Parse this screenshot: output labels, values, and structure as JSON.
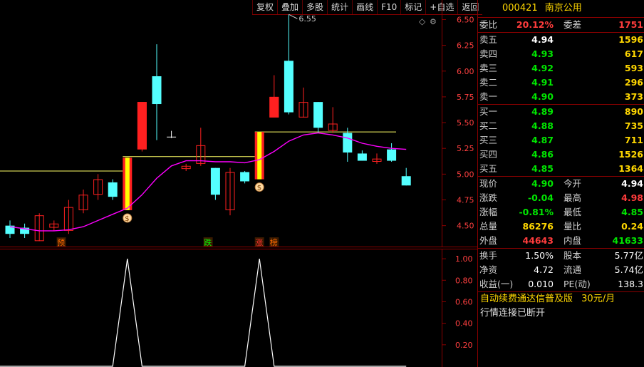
{
  "toolbar": [
    "复权",
    "叠加",
    "多股",
    "统计",
    "画线",
    "F10",
    "标记",
    "+自选",
    "返回"
  ],
  "stock": {
    "code": "000421",
    "name": "南京公用"
  },
  "ratio": {
    "label": "委比",
    "value": "20.12%",
    "label2": "委差",
    "value2": "1751"
  },
  "asks": [
    {
      "label": "卖五",
      "price": "4.94",
      "vol": "1596"
    },
    {
      "label": "卖四",
      "price": "4.93",
      "vol": "617"
    },
    {
      "label": "卖三",
      "price": "4.92",
      "vol": "593"
    },
    {
      "label": "卖二",
      "price": "4.91",
      "vol": "296"
    },
    {
      "label": "卖一",
      "price": "4.90",
      "vol": "373"
    }
  ],
  "bids": [
    {
      "label": "买一",
      "price": "4.89",
      "vol": "890"
    },
    {
      "label": "买二",
      "price": "4.88",
      "vol": "735"
    },
    {
      "label": "买三",
      "price": "4.87",
      "vol": "711"
    },
    {
      "label": "买四",
      "price": "4.86",
      "vol": "1526"
    },
    {
      "label": "买五",
      "price": "4.85",
      "vol": "1364"
    }
  ],
  "quote": [
    {
      "l1": "现价",
      "v1": "4.90",
      "c1": "green",
      "l2": "今开",
      "v2": "4.94",
      "c2": "white"
    },
    {
      "l1": "涨跌",
      "v1": "-0.04",
      "c1": "green",
      "l2": "最高",
      "v2": "4.98",
      "c2": "red"
    },
    {
      "l1": "涨幅",
      "v1": "-0.81%",
      "c1": "green",
      "l2": "最低",
      "v2": "4.85",
      "c2": "green"
    },
    {
      "l1": "总量",
      "v1": "86276",
      "c1": "yellow",
      "l2": "量比",
      "v2": "0.24",
      "c2": "yellow"
    },
    {
      "l1": "外盘",
      "v1": "44643",
      "c1": "red",
      "l2": "内盘",
      "v2": "41633",
      "c2": "green"
    }
  ],
  "fundamentals": [
    {
      "l1": "换手",
      "v1": "1.50%",
      "l2": "股本",
      "v2": "5.77亿"
    },
    {
      "l1": "净资",
      "v1": "4.72",
      "l2": "流通",
      "v2": "5.74亿"
    },
    {
      "l1": "收益(一)",
      "v1": "0.010",
      "l2": "PE(动)",
      "v2": "138.3"
    }
  ],
  "promo": {
    "text": "自动续费通达信普及版",
    "price": "30元/月"
  },
  "status": "行情连接已断开",
  "colors": {
    "up": "#ff2020",
    "down": "#54ffff",
    "ma": "#ff00ff",
    "ref_line": "#ffff66",
    "border": "#8b0000"
  },
  "chart_data": [
    {
      "type": "candlestick",
      "price_axis": {
        "ticks": [
          "6.50",
          "6.25",
          "6.00",
          "5.75",
          "5.50",
          "5.25",
          "5.00",
          "4.75",
          "4.50"
        ],
        "range": [
          4.29,
          6.69
        ]
      },
      "peak_label": "6.55",
      "candles": [
        {
          "o": 4.5,
          "c": 4.42,
          "h": 4.55,
          "l": 4.38
        },
        {
          "o": 4.48,
          "c": 4.42,
          "h": 4.52,
          "l": 4.38
        },
        {
          "o": 4.35,
          "c": 4.6,
          "h": 4.62,
          "l": 4.35
        },
        {
          "o": 4.48,
          "c": 4.52,
          "h": 4.55,
          "l": 4.45
        },
        {
          "o": 4.45,
          "c": 4.68,
          "h": 4.75,
          "l": 4.42
        },
        {
          "o": 4.65,
          "c": 4.8,
          "h": 4.85,
          "l": 4.62
        },
        {
          "o": 4.8,
          "c": 4.95,
          "h": 5.0,
          "l": 4.75
        },
        {
          "o": 4.92,
          "c": 4.78,
          "h": 4.95,
          "l": 4.75
        },
        {
          "o": 4.65,
          "c": 5.16,
          "h": 5.16,
          "l": 4.65,
          "limit": true
        },
        {
          "o": 5.24,
          "c": 5.7,
          "h": 5.7,
          "l": 5.22
        },
        {
          "o": 5.95,
          "c": 5.68,
          "h": 6.26,
          "l": 5.33
        },
        {
          "o": 5.36,
          "c": 5.36,
          "h": 5.42,
          "l": 5.35
        },
        {
          "o": 5.05,
          "c": 5.08,
          "h": 5.1,
          "l": 5.03
        },
        {
          "o": 5.1,
          "c": 5.28,
          "h": 5.45,
          "l": 5.08
        },
        {
          "o": 5.06,
          "c": 4.8,
          "h": 5.06,
          "l": 4.75
        },
        {
          "o": 4.65,
          "c": 5.02,
          "h": 5.06,
          "l": 4.6
        },
        {
          "o": 5.02,
          "c": 4.93,
          "h": 5.03,
          "l": 4.91
        },
        {
          "o": 4.95,
          "c": 5.41,
          "h": 5.41,
          "l": 4.95,
          "limit": true
        },
        {
          "o": 5.55,
          "c": 5.75,
          "h": 5.96,
          "l": 5.55
        },
        {
          "o": 6.1,
          "c": 5.6,
          "h": 6.55,
          "l": 5.58
        },
        {
          "o": 5.55,
          "c": 5.7,
          "h": 5.84,
          "l": 5.55
        },
        {
          "o": 5.7,
          "c": 5.45,
          "h": 5.7,
          "l": 5.4
        },
        {
          "o": 5.42,
          "c": 5.49,
          "h": 5.65,
          "l": 5.4
        },
        {
          "o": 5.4,
          "c": 5.21,
          "h": 5.45,
          "l": 5.12
        },
        {
          "o": 5.2,
          "c": 5.13,
          "h": 5.23,
          "l": 5.13
        },
        {
          "o": 5.12,
          "c": 5.15,
          "h": 5.2,
          "l": 5.1
        },
        {
          "o": 5.24,
          "c": 5.13,
          "h": 5.3,
          "l": 5.12
        },
        {
          "o": 4.98,
          "c": 4.89,
          "h": 5.06,
          "l": 4.89
        }
      ],
      "ma": [
        4.49,
        4.47,
        4.45,
        4.45,
        4.46,
        4.49,
        4.55,
        4.61,
        4.67,
        4.8,
        4.96,
        5.08,
        5.13,
        5.13,
        5.12,
        5.12,
        5.11,
        5.14,
        5.22,
        5.32,
        5.38,
        5.4,
        5.38,
        5.35,
        5.3,
        5.27,
        5.25,
        5.24
      ],
      "ref_lines": [
        {
          "price": 5.03,
          "from": 0,
          "to": 8
        },
        {
          "price": 5.17,
          "from": 8,
          "to": 17
        },
        {
          "price": 5.41,
          "from": 17,
          "to": 28
        }
      ],
      "signals": [
        {
          "index": 3.5,
          "text": "预",
          "color": "#ff6a00"
        },
        {
          "index": 13.5,
          "text": "跌",
          "color": "#00ff00"
        },
        {
          "index": 17.0,
          "text": "涨",
          "color": "#ff3030"
        },
        {
          "index": 18.0,
          "text": "榜",
          "color": "#ff6a00"
        }
      ]
    },
    {
      "type": "line",
      "y_axis": {
        "ticks": [
          "1.00",
          "0.80",
          "0.60",
          "0.40",
          "0.20"
        ],
        "range": [
          0,
          1.1
        ]
      },
      "values": [
        0,
        0,
        0,
        0,
        0,
        0,
        0,
        0,
        1,
        0,
        0,
        0,
        0,
        0,
        0,
        0,
        0,
        1,
        0,
        0,
        0,
        0,
        0,
        0,
        0,
        0,
        0,
        0
      ]
    }
  ]
}
